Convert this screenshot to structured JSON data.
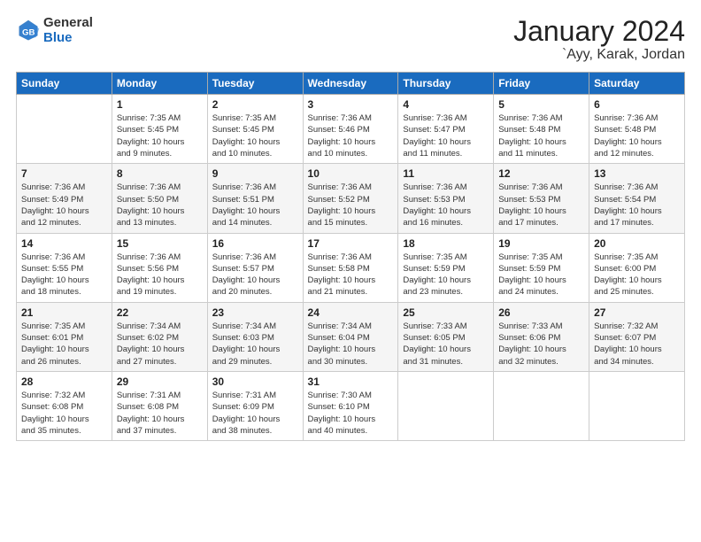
{
  "header": {
    "logo_general": "General",
    "logo_blue": "Blue",
    "month_title": "January 2024",
    "location": "`Ayy, Karak, Jordan"
  },
  "days_of_week": [
    "Sunday",
    "Monday",
    "Tuesday",
    "Wednesday",
    "Thursday",
    "Friday",
    "Saturday"
  ],
  "weeks": [
    [
      {
        "day": "",
        "info": ""
      },
      {
        "day": "1",
        "info": "Sunrise: 7:35 AM\nSunset: 5:45 PM\nDaylight: 10 hours\nand 9 minutes."
      },
      {
        "day": "2",
        "info": "Sunrise: 7:35 AM\nSunset: 5:45 PM\nDaylight: 10 hours\nand 10 minutes."
      },
      {
        "day": "3",
        "info": "Sunrise: 7:36 AM\nSunset: 5:46 PM\nDaylight: 10 hours\nand 10 minutes."
      },
      {
        "day": "4",
        "info": "Sunrise: 7:36 AM\nSunset: 5:47 PM\nDaylight: 10 hours\nand 11 minutes."
      },
      {
        "day": "5",
        "info": "Sunrise: 7:36 AM\nSunset: 5:48 PM\nDaylight: 10 hours\nand 11 minutes."
      },
      {
        "day": "6",
        "info": "Sunrise: 7:36 AM\nSunset: 5:48 PM\nDaylight: 10 hours\nand 12 minutes."
      }
    ],
    [
      {
        "day": "7",
        "info": "Sunrise: 7:36 AM\nSunset: 5:49 PM\nDaylight: 10 hours\nand 12 minutes."
      },
      {
        "day": "8",
        "info": "Sunrise: 7:36 AM\nSunset: 5:50 PM\nDaylight: 10 hours\nand 13 minutes."
      },
      {
        "day": "9",
        "info": "Sunrise: 7:36 AM\nSunset: 5:51 PM\nDaylight: 10 hours\nand 14 minutes."
      },
      {
        "day": "10",
        "info": "Sunrise: 7:36 AM\nSunset: 5:52 PM\nDaylight: 10 hours\nand 15 minutes."
      },
      {
        "day": "11",
        "info": "Sunrise: 7:36 AM\nSunset: 5:53 PM\nDaylight: 10 hours\nand 16 minutes."
      },
      {
        "day": "12",
        "info": "Sunrise: 7:36 AM\nSunset: 5:53 PM\nDaylight: 10 hours\nand 17 minutes."
      },
      {
        "day": "13",
        "info": "Sunrise: 7:36 AM\nSunset: 5:54 PM\nDaylight: 10 hours\nand 17 minutes."
      }
    ],
    [
      {
        "day": "14",
        "info": "Sunrise: 7:36 AM\nSunset: 5:55 PM\nDaylight: 10 hours\nand 18 minutes."
      },
      {
        "day": "15",
        "info": "Sunrise: 7:36 AM\nSunset: 5:56 PM\nDaylight: 10 hours\nand 19 minutes."
      },
      {
        "day": "16",
        "info": "Sunrise: 7:36 AM\nSunset: 5:57 PM\nDaylight: 10 hours\nand 20 minutes."
      },
      {
        "day": "17",
        "info": "Sunrise: 7:36 AM\nSunset: 5:58 PM\nDaylight: 10 hours\nand 21 minutes."
      },
      {
        "day": "18",
        "info": "Sunrise: 7:35 AM\nSunset: 5:59 PM\nDaylight: 10 hours\nand 23 minutes."
      },
      {
        "day": "19",
        "info": "Sunrise: 7:35 AM\nSunset: 5:59 PM\nDaylight: 10 hours\nand 24 minutes."
      },
      {
        "day": "20",
        "info": "Sunrise: 7:35 AM\nSunset: 6:00 PM\nDaylight: 10 hours\nand 25 minutes."
      }
    ],
    [
      {
        "day": "21",
        "info": "Sunrise: 7:35 AM\nSunset: 6:01 PM\nDaylight: 10 hours\nand 26 minutes."
      },
      {
        "day": "22",
        "info": "Sunrise: 7:34 AM\nSunset: 6:02 PM\nDaylight: 10 hours\nand 27 minutes."
      },
      {
        "day": "23",
        "info": "Sunrise: 7:34 AM\nSunset: 6:03 PM\nDaylight: 10 hours\nand 29 minutes."
      },
      {
        "day": "24",
        "info": "Sunrise: 7:34 AM\nSunset: 6:04 PM\nDaylight: 10 hours\nand 30 minutes."
      },
      {
        "day": "25",
        "info": "Sunrise: 7:33 AM\nSunset: 6:05 PM\nDaylight: 10 hours\nand 31 minutes."
      },
      {
        "day": "26",
        "info": "Sunrise: 7:33 AM\nSunset: 6:06 PM\nDaylight: 10 hours\nand 32 minutes."
      },
      {
        "day": "27",
        "info": "Sunrise: 7:32 AM\nSunset: 6:07 PM\nDaylight: 10 hours\nand 34 minutes."
      }
    ],
    [
      {
        "day": "28",
        "info": "Sunrise: 7:32 AM\nSunset: 6:08 PM\nDaylight: 10 hours\nand 35 minutes."
      },
      {
        "day": "29",
        "info": "Sunrise: 7:31 AM\nSunset: 6:08 PM\nDaylight: 10 hours\nand 37 minutes."
      },
      {
        "day": "30",
        "info": "Sunrise: 7:31 AM\nSunset: 6:09 PM\nDaylight: 10 hours\nand 38 minutes."
      },
      {
        "day": "31",
        "info": "Sunrise: 7:30 AM\nSunset: 6:10 PM\nDaylight: 10 hours\nand 40 minutes."
      },
      {
        "day": "",
        "info": ""
      },
      {
        "day": "",
        "info": ""
      },
      {
        "day": "",
        "info": ""
      }
    ]
  ]
}
